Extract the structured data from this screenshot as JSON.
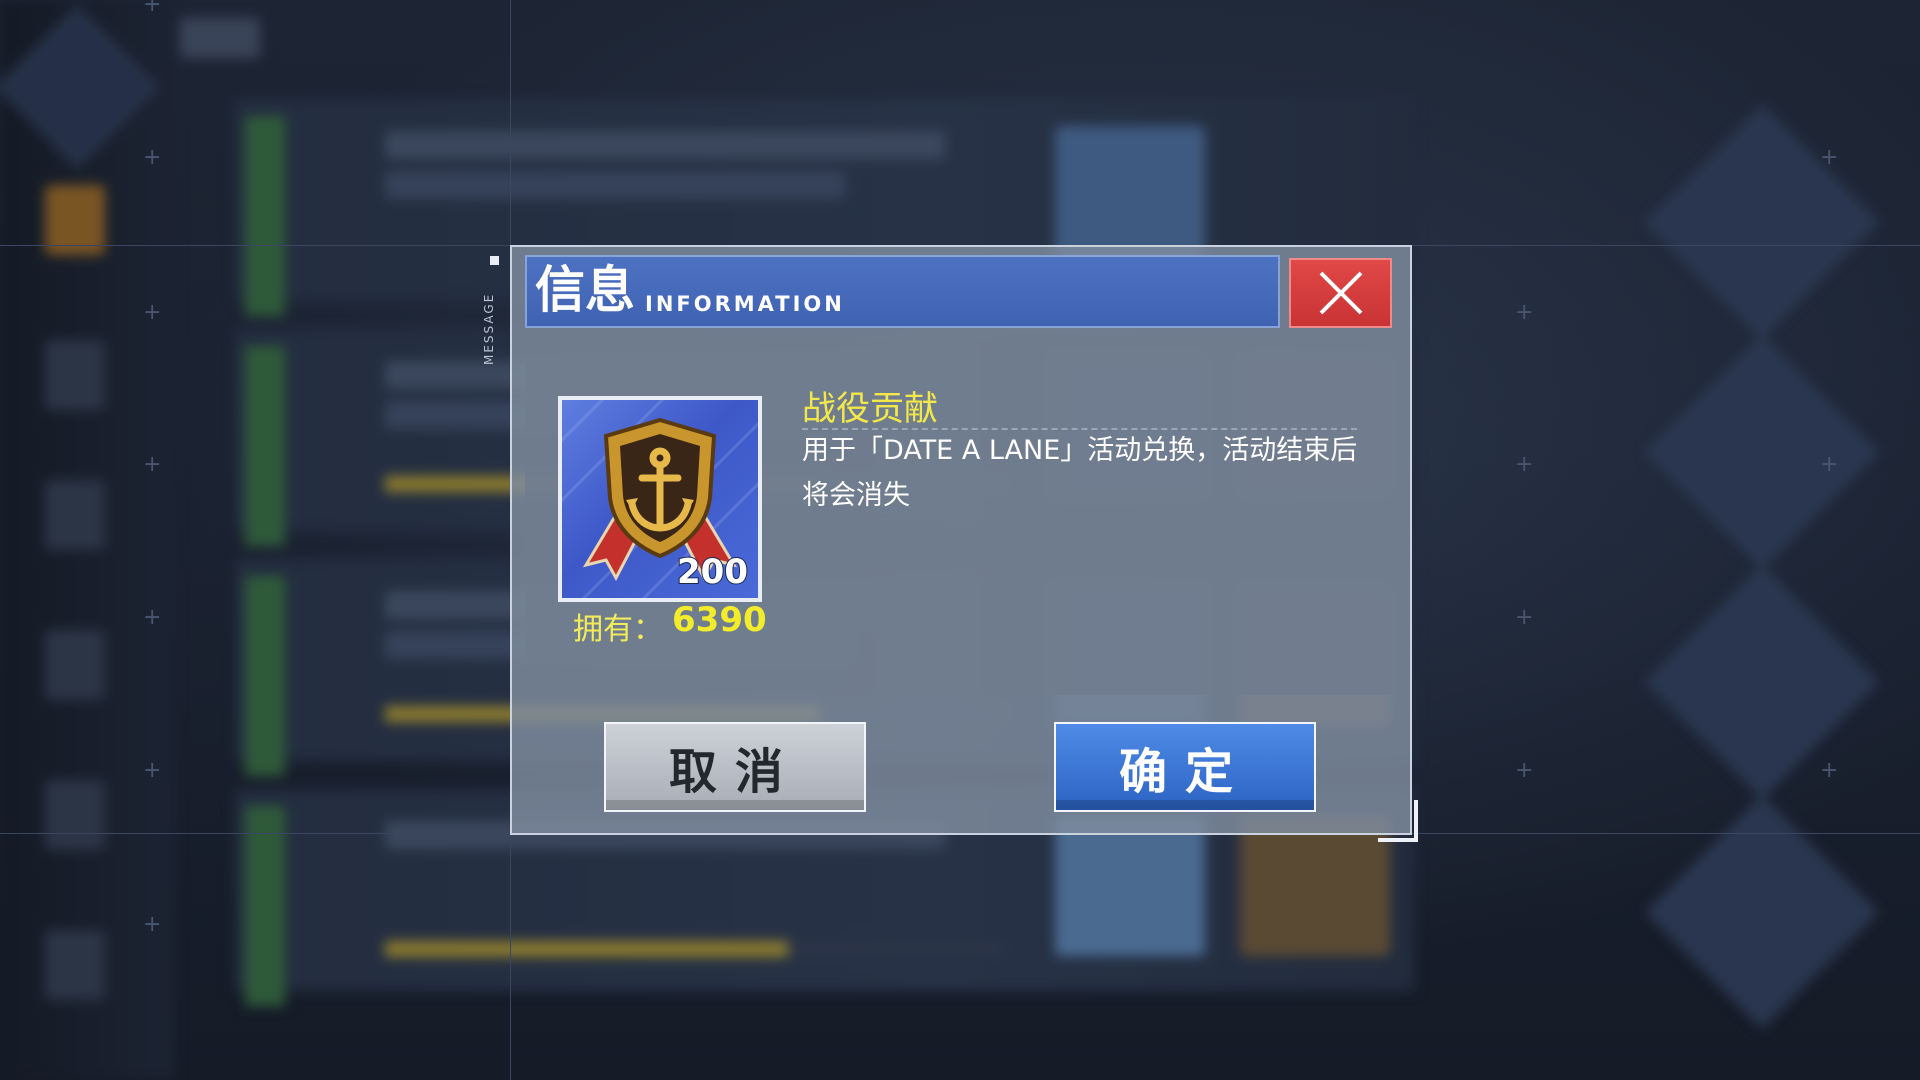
{
  "dialog": {
    "side_label": "MESSAGE",
    "title_cn": "信息",
    "title_en": "INFORMATION",
    "close_icon": "close-icon"
  },
  "item": {
    "name": "战役贡献",
    "description": "用于「DATE A LANE」活动兑换，活动结束后将会消失",
    "count": "200",
    "icon": "anchor-shield-medal-icon",
    "owned_label": "拥有：",
    "owned_value": "6390"
  },
  "buttons": {
    "cancel": "取消",
    "confirm": "确定"
  },
  "colors": {
    "header_blue": "#4e72c2",
    "close_red": "#d63e3e",
    "item_name_yellow": "#f2e84a",
    "confirm_blue": "#3b76d6",
    "cancel_gray": "#b9bec6"
  }
}
